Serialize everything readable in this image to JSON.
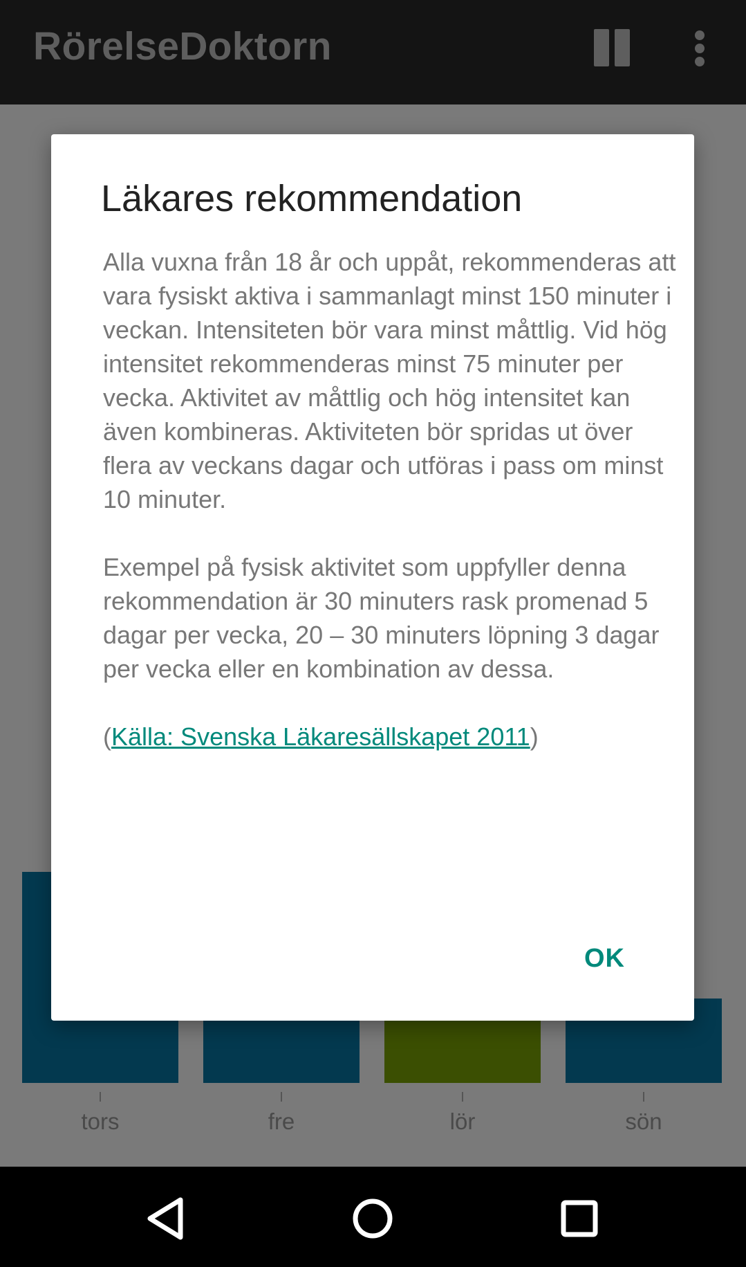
{
  "app": {
    "title": "RörelseDoktorn"
  },
  "toolbar": {
    "pause_icon": "pause-icon",
    "overflow_icon": "more-vert-icon"
  },
  "chart_data": {
    "type": "bar",
    "categories": [
      "tors",
      "fre",
      "lör",
      "sön"
    ],
    "colors": [
      "#03394f",
      "#03394f",
      "#3b4f02",
      "#03394f"
    ]
  },
  "dialog": {
    "title": "Läkares rekommendation",
    "paragraph1": "Alla vuxna från 18 år och uppåt, rekommenderas att vara fysiskt aktiva i sammanlagt minst 150 minuter i veckan. Intensiteten bör vara minst måttlig. Vid hög intensitet rekommenderas minst 75 minuter per vecka. Aktivitet av måttlig och hög intensitet kan även kombineras. Aktiviteten bör spridas ut över flera av veckans dagar och utföras i pass om minst 10 minuter.",
    "paragraph2": "Exempel på fysisk aktivitet som uppfyller denna rekommendation är 30 minuters rask promenad 5 dagar per vecka, 20 – 30 minuters löpning 3 dagar per vecka eller en kombination av dessa.",
    "source_open": "(",
    "source_link": "Källa: Svenska Läkaresällskapet 2011",
    "source_close": ")",
    "ok_label": "OK"
  },
  "navbar": {
    "back_icon": "back-icon",
    "home_icon": "home-icon",
    "recents_icon": "recents-icon"
  }
}
